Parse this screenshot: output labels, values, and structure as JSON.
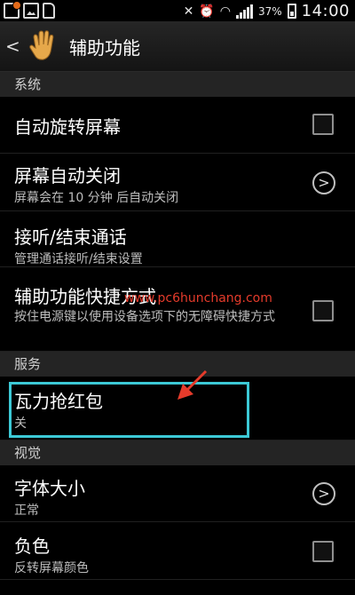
{
  "status_bar": {
    "battery_percent": "37%",
    "time": "14:00"
  },
  "action_bar": {
    "title": "辅助功能"
  },
  "sections": {
    "system": "系统",
    "services": "服务",
    "vision": "视觉"
  },
  "items": {
    "auto_rotate": {
      "title": "自动旋转屏幕"
    },
    "screen_off": {
      "title": "屏幕自动关闭",
      "subtitle": "屏幕会在 10 分钟 后自动关闭"
    },
    "call_answer": {
      "title": "接听/结束通话",
      "subtitle": "管理通话接听/结束设置"
    },
    "shortcut": {
      "title": "辅助功能快捷方式",
      "subtitle": "按住电源键以使用设备选项下的无障碍快捷方式"
    },
    "red_packet": {
      "title": "瓦力抢红包",
      "subtitle": "关"
    },
    "font_size": {
      "title": "字体大小",
      "subtitle": "正常"
    },
    "negative": {
      "title": "负色",
      "subtitle": "反转屏幕颜色"
    }
  },
  "watermark": "www.pc6hunchang.com",
  "colors": {
    "highlight": "#3cc9d6",
    "arrow": "#e53b2b",
    "section_bg": "#242424"
  }
}
